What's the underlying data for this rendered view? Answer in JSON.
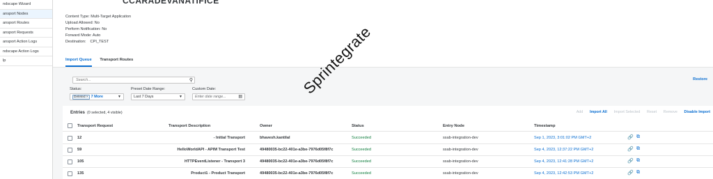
{
  "sidebar": {
    "items": [
      {
        "label": "ndscape Wizard"
      },
      {
        "label": "ansport Nodes"
      },
      {
        "label": "ansport Routes"
      },
      {
        "label": "ansport Requests"
      },
      {
        "label": "ansport Action Logs"
      },
      {
        "label": "ndscape Action Logs"
      },
      {
        "label": "lp"
      }
    ]
  },
  "header": {
    "title_fragment": "CCARADEVANATIFICE",
    "properties": [
      {
        "label": "Content Type: Multi-Target Application",
        "value": ""
      },
      {
        "label": "Upload Allowed: No",
        "value": ""
      },
      {
        "label": "Perform Notification: No",
        "value": ""
      },
      {
        "label": "Forward Mode: Auto",
        "value": ""
      },
      {
        "label": "Destination:",
        "value": "CPI_TEST"
      }
    ],
    "tabs": [
      {
        "label": "Import Queue"
      },
      {
        "label": "Transport Routes"
      }
    ]
  },
  "filters": {
    "search_placeholder": "Search...",
    "restore_label": "Restore",
    "status_label": "Status:",
    "status_token": "Deleted ×",
    "status_more": "7 More",
    "date_range_label": "Preset Date Range:",
    "date_range_value": "Last 7 Days",
    "custom_date_label": "Custom Date:",
    "custom_date_placeholder": "Enter date range..."
  },
  "table": {
    "title": "Entries",
    "subtitle": "(0 selected, 4 visible)",
    "toolbar": {
      "add": "Add",
      "import_all": "Import All",
      "import_selected": "Import Selected",
      "reset": "Reset",
      "remove": "Remove",
      "disable_import": "Disable Import"
    },
    "columns": {
      "request": "Transport Request",
      "description": "Transport Description",
      "owner": "Owner",
      "status": "Status",
      "entry_node": "Entry Node",
      "timestamp": "Timestamp"
    },
    "rows": [
      {
        "request": "12",
        "description": "- Initial Transport",
        "owner": "bhavesh.kantilal",
        "status": "Succeeded",
        "entry_node": "ssab-integration-dev",
        "timestamp": "Sep 1, 2023, 3:01:02 PM GMT+2"
      },
      {
        "request": "59",
        "description": "HelloWorldAPI - APIM Transport Test",
        "owner": "49480035-bc22-401e-a3be-7976d05f8f7c",
        "status": "Succeeded",
        "entry_node": "ssab-integration-dev",
        "timestamp": "Sep 4, 2023, 12:37:22 PM GMT+2"
      },
      {
        "request": "105",
        "description": "HTTPEventListener - Transport 3",
        "owner": "49480035-bc22-401e-a3be-7976d05f8f7c",
        "status": "Succeeded",
        "entry_node": "ssab-integration-dev",
        "timestamp": "Sep 4, 2023, 12:41:28 PM GMT+2"
      },
      {
        "request": "135",
        "description": "Product1 - Product Transport",
        "owner": "49480035-bc22-401e-a3be-7976d05f8f7c",
        "status": "Succeeded",
        "entry_node": "ssab-integration-dev",
        "timestamp": "Sep 4, 2023, 12:42:53 PM GMT+2"
      }
    ]
  },
  "watermark": "Sprintegrate",
  "icons": {
    "search": "search-icon",
    "chevron": "chevron-down-icon",
    "calendar": "calendar-icon",
    "link": "link-icon",
    "copy": "copy-icon"
  },
  "colors": {
    "accent": "#0a6ed1",
    "success": "#107e3e"
  }
}
